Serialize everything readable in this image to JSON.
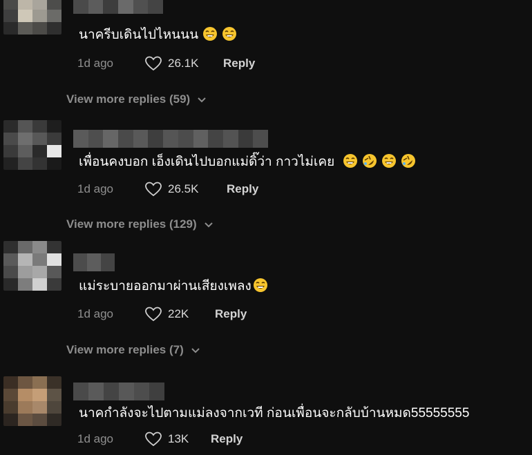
{
  "comments": [
    {
      "text": "นาครีบเดินไปไหนนน",
      "emojis": [
        "laughing-face-icon",
        "laughing-face-icon"
      ],
      "time": "1d ago",
      "likes": "26.1K",
      "reply_label": "Reply",
      "view_more": "View more replies (59)"
    },
    {
      "text": "เพื่อนคงบอก เอ็งเดินไปบอกแม่ดิ๊ว่า กาวไม่เคย",
      "emojis": [
        "laughing-face-icon",
        "rolling-laughing-face-icon",
        "laughing-face-icon",
        "rolling-laughing-face-icon"
      ],
      "time": "1d ago",
      "likes": "26.5K",
      "reply_label": "Reply",
      "view_more": "View more replies (129)"
    },
    {
      "text": "แม่ระบายออกมาผ่านเสียงเพลง",
      "emojis": [
        "laughing-face-icon"
      ],
      "time": "1d ago",
      "likes": "22K",
      "reply_label": "Reply",
      "view_more": "View more replies (7)"
    },
    {
      "text": "นาคกำลังจะไปตามแม่ลงจากเวที ก่อนเพื่อนจะกลับบ้านหมด55555555",
      "emojis": [],
      "time": "1d ago",
      "likes": "13K",
      "reply_label": "Reply"
    }
  ],
  "colors": {
    "background": "#0f0f0f",
    "muted_text": "#8f8f8f",
    "emoji_yellow": "#f7c52e"
  }
}
